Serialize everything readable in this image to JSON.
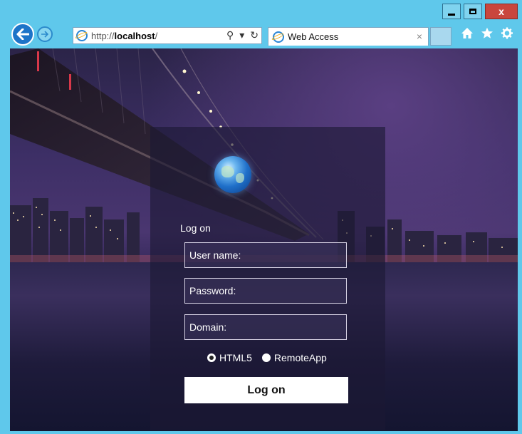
{
  "browser": {
    "url_scheme": "http://",
    "url_host": "localhost",
    "url_path": "/",
    "tab_title": "Web Access",
    "tab_close": "×",
    "search_glyph": "⚲",
    "dropdown_glyph": "▾",
    "refresh_glyph": "↻",
    "home_icon": "home-icon",
    "favorites_icon": "star-icon",
    "tools_icon": "gear-icon"
  },
  "window": {
    "minimize": "_",
    "maximize": "□",
    "close": "x"
  },
  "login": {
    "heading": "Log on",
    "username_placeholder": "User name:",
    "password_placeholder": "Password:",
    "domain_placeholder": "Domain:",
    "mode_html5": "HTML5",
    "mode_remoteapp": "RemoteApp",
    "selected_mode": "HTML5",
    "submit_label": "Log on"
  }
}
